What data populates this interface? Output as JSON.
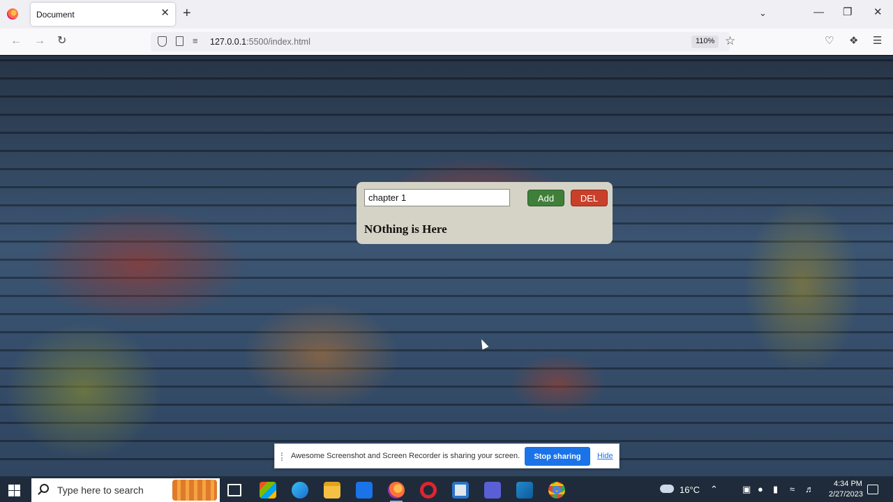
{
  "browser": {
    "tab_title": "Document",
    "tab_close": "✕",
    "new_tab": "+",
    "url_host": "127.0.0.1",
    "url_rest": ":5500/index.html",
    "zoom": "110%"
  },
  "app": {
    "input_value": "chapter 1",
    "add_label": "Add",
    "del_label": "DEL",
    "empty_message": "NOthing is Here"
  },
  "share_bar": {
    "message": "Awesome Screenshot and Screen Recorder is sharing your screen.",
    "stop_label": "Stop sharing",
    "hide_label": "Hide"
  },
  "taskbar": {
    "search_placeholder": "Type here to search",
    "temperature": "16°C",
    "time": "4:34 PM",
    "date": "2/27/2023"
  },
  "colors": {
    "add_button": "#3f7f3a",
    "del_button": "#c9402a",
    "card_bg": "#d4d3c6",
    "stop_sharing": "#1a73e8"
  }
}
